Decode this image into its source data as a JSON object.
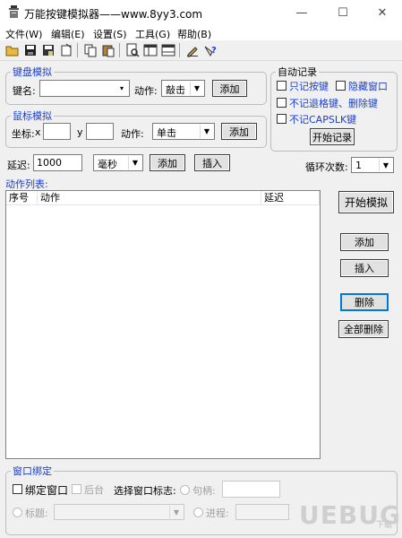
{
  "window": {
    "title": "万能按键模拟器——www.8yy3.com",
    "minimize": "—",
    "maximize": "☐",
    "close": "✕"
  },
  "menu": [
    "文件(W)",
    "编辑(E)",
    "设置(S)",
    "工具(G)",
    "帮助(B)"
  ],
  "toolbar": [
    "open-folder-icon",
    "save-icon",
    "save-as-icon",
    "open-file-icon",
    "copy-icon",
    "paste-icon",
    "print-preview-icon",
    "window-icon",
    "window-2-icon",
    "edit-icon",
    "help-icon"
  ],
  "keyboard": {
    "title": "键盘模拟",
    "key_label": "键名:",
    "key_value": "",
    "action_label": "动作:",
    "action_value": "敲击",
    "add": "添加"
  },
  "mouse": {
    "title": "鼠标模拟",
    "coord_label": "坐标:",
    "x_label": "x",
    "y_label": "y",
    "x_value": "",
    "y_value": "",
    "action_label": "动作:",
    "action_value": "单击",
    "add": "添加"
  },
  "autorecord": {
    "title": "自动记录",
    "only_keys": "只记按键",
    "hide_window": "隐藏窗口",
    "skip_backspace": "不记退格键、删除键",
    "skip_capslk": "不记CAPSLK键",
    "start": "开始记录"
  },
  "delay": {
    "label": "延迟:",
    "value": "1000",
    "unit": "毫秒",
    "add": "添加",
    "insert": "插入"
  },
  "loop": {
    "label": "循环次数:",
    "value": "1"
  },
  "actions": {
    "title": "动作列表:",
    "columns": [
      "序号",
      "动作",
      "延迟"
    ],
    "rows": []
  },
  "side_buttons": {
    "start_sim": "开始模拟",
    "add": "添加",
    "insert": "插入",
    "delete": "删除",
    "delete_all": "全部删除"
  },
  "bind": {
    "title": "窗口绑定",
    "bind_window": "绑定窗口",
    "background": "后台",
    "select_flag": "选择窗口标志:",
    "handle": "句柄:",
    "handle_value": "",
    "title_label": "标题:",
    "title_value": "",
    "process": "进程:",
    "process_value": ""
  },
  "watermark": "UEBUG",
  "watermark_sub": "下载"
}
